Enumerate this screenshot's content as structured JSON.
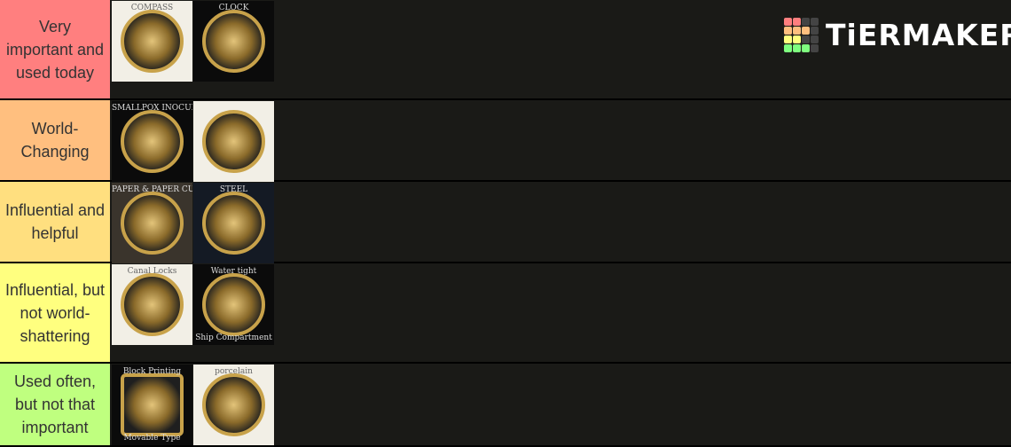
{
  "logo": {
    "text": "TiERMAKER",
    "grid_colors": [
      "#ff7f7f",
      "#ff7f7f",
      "#444",
      "#444",
      "#ffbf7f",
      "#ffbf7f",
      "#ffbf7f",
      "#444",
      "#ffff7f",
      "#ffff7f",
      "#444",
      "#444",
      "#7fff7f",
      "#7fff7f",
      "#7fff7f",
      "#444"
    ]
  },
  "tiers": [
    {
      "label": "Very important and used today",
      "color": "#ff7f7f",
      "items": [
        {
          "name": "compass",
          "caption": "COMPASS",
          "bg": "light"
        },
        {
          "name": "clock",
          "caption": "CLOCK",
          "bg": "dark"
        }
      ]
    },
    {
      "label": "World-Changing",
      "color": "#ffbf7f",
      "items": [
        {
          "name": "smallpox-inoculation",
          "caption": "SMALLPOX INOCULATION",
          "bg": "dark"
        },
        {
          "name": "gunpowder",
          "caption": "",
          "bg": "light"
        }
      ]
    },
    {
      "label": "Influential and helpful",
      "color": "#ffdf7f",
      "items": [
        {
          "name": "paper-currency",
          "caption": "PAPER & PAPER CURRENCY",
          "bg": "brown"
        },
        {
          "name": "steel",
          "caption": "STEEL",
          "bg": "navy"
        }
      ]
    },
    {
      "label": "Influential, but not world-shattering",
      "color": "#ffff7f",
      "items": [
        {
          "name": "canal-locks",
          "caption": "Canal Locks",
          "bg": "light"
        },
        {
          "name": "watertight-compartment",
          "caption": "Water tight",
          "caption2": "Ship Compartment",
          "bg": "dark"
        }
      ]
    },
    {
      "label": "Used often, but not that important",
      "color": "#bfff7f",
      "items": [
        {
          "name": "block-printing",
          "caption": "Block Printing",
          "caption2": "Movable Type",
          "bg": "dark"
        },
        {
          "name": "porcelain",
          "caption": "porcelain",
          "bg": "light"
        }
      ]
    }
  ]
}
